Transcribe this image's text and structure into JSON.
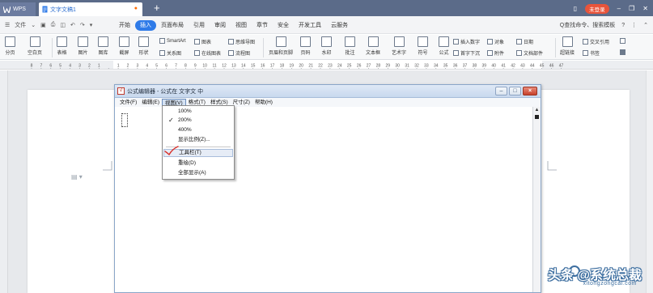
{
  "titlebar": {
    "app_tab": "WPS",
    "doc_tab": "文字文稿1",
    "new_tab": "+",
    "login_label": "未登录"
  },
  "menubar": {
    "file_label": "文件",
    "tabs": [
      {
        "label": "开始"
      },
      {
        "label": "插入"
      },
      {
        "label": "页面布局"
      },
      {
        "label": "引用"
      },
      {
        "label": "审阅"
      },
      {
        "label": "视图"
      },
      {
        "label": "章节"
      },
      {
        "label": "安全"
      },
      {
        "label": "开发工具"
      },
      {
        "label": "云服务"
      }
    ],
    "active_tab": "插入",
    "search_label": "Q查找命令、搜索模板",
    "help": "?"
  },
  "ribbon": {
    "big_items": [
      {
        "label": "分页"
      },
      {
        "label": "空白页"
      },
      {
        "label": "表格"
      },
      {
        "label": "图片"
      },
      {
        "label": "图库"
      },
      {
        "label": "截屏"
      },
      {
        "label": "形状"
      },
      {
        "label": "页眉和页脚"
      },
      {
        "label": "页码"
      },
      {
        "label": "水印"
      },
      {
        "label": "批注"
      },
      {
        "label": "文本框"
      },
      {
        "label": "艺术字"
      },
      {
        "label": "符号"
      },
      {
        "label": "公式"
      },
      {
        "label": "超链接"
      }
    ],
    "small_items": {
      "smartart": "SmartArt",
      "chart": "图表",
      "mindmap": "思维导图",
      "relation": "关系图",
      "online_chart": "在线图表",
      "flowchart": "流程图",
      "insert_number": "插入数字",
      "object": "对象",
      "date": "日期",
      "dropcap": "首字下沉",
      "attachment": "附件",
      "doc_parts": "文档部件",
      "cross_ref": "交叉引用",
      "bookmark": "书签"
    }
  },
  "ruler": {
    "labels": [
      "8",
      "7",
      "6",
      "5",
      "4",
      "3",
      "2",
      "1",
      "",
      "1",
      "2",
      "3",
      "4",
      "5",
      "6",
      "7",
      "8",
      "9",
      "10",
      "11",
      "12",
      "13",
      "14",
      "15",
      "16",
      "17",
      "18",
      "19",
      "20",
      "21",
      "22",
      "23",
      "24",
      "25",
      "26",
      "27",
      "28",
      "29",
      "30",
      "31",
      "32",
      "33",
      "34",
      "35",
      "36",
      "37",
      "38",
      "39",
      "40",
      "41",
      "42",
      "43",
      "44",
      "45",
      "46",
      "47"
    ]
  },
  "dialog": {
    "title": "公式编辑器 - 公式在 文字文 中",
    "menu": [
      {
        "label": "文件(F)"
      },
      {
        "label": "编辑(E)"
      },
      {
        "label": "视图(V)"
      },
      {
        "label": "格式(T)"
      },
      {
        "label": "样式(S)"
      },
      {
        "label": "尺寸(Z)"
      },
      {
        "label": "帮助(H)"
      }
    ],
    "open_menu": "视图(V)",
    "view_menu": {
      "items": [
        {
          "label": "100%",
          "checked": false
        },
        {
          "label": "200%",
          "checked": true
        },
        {
          "label": "400%",
          "checked": false
        },
        {
          "label": "显示比例(Z)...",
          "checked": false
        },
        {
          "label": "工具栏(T)",
          "checked": false,
          "highlighted": true
        },
        {
          "label": "重绘(D)",
          "checked": false
        },
        {
          "label": "全部显示(A)",
          "checked": false
        }
      ]
    },
    "controls": {
      "minimize": "–",
      "maximize": "□",
      "close": "×"
    }
  },
  "watermark": {
    "text": "头条 @系统总裁",
    "url": "xitongzongcai.com"
  },
  "colors": {
    "titlebar": "#5b6b89",
    "active_tab": "#2f7be8",
    "login_badge": "#e8543b",
    "annotation_tick": "#d9302a"
  }
}
